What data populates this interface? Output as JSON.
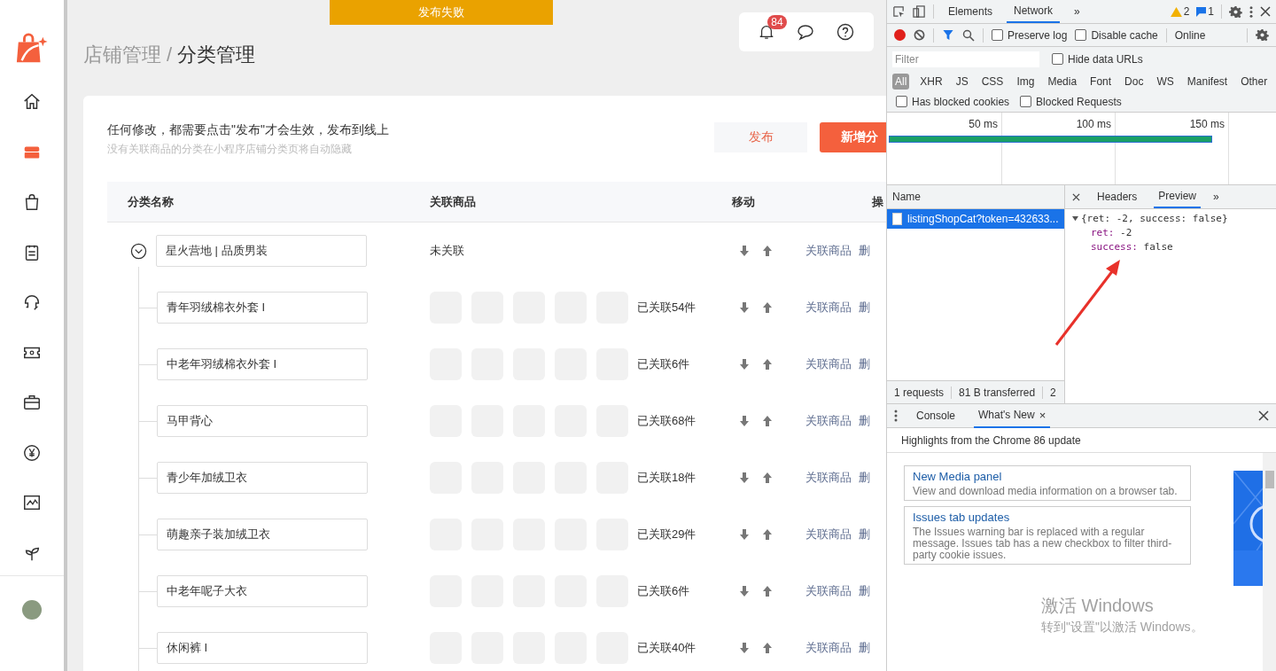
{
  "toast": {
    "text": "发布失败"
  },
  "sidebar": {
    "items": [
      {
        "kind": "home",
        "selected": false
      },
      {
        "kind": "store",
        "selected": true
      },
      {
        "kind": "bag",
        "selected": false
      },
      {
        "kind": "clipboard",
        "selected": false
      },
      {
        "kind": "headset",
        "selected": false
      },
      {
        "kind": "ticket",
        "selected": false
      },
      {
        "kind": "briefcase",
        "selected": false
      },
      {
        "kind": "yen",
        "selected": false
      },
      {
        "kind": "chart",
        "selected": false
      },
      {
        "kind": "sprout",
        "selected": false
      }
    ]
  },
  "header": {
    "breadcrumb": [
      {
        "label": "店铺管理",
        "current": false
      },
      {
        "label": "分类管理",
        "current": true
      }
    ],
    "separator": "/",
    "notification_count": "84"
  },
  "notice": {
    "title": "任何修改，都需要点击\"发布\"才会生效，发布到线上",
    "subtitle": "没有关联商品的分类在小程序店铺分类页将自动隐藏"
  },
  "buttons": {
    "publish": "发布",
    "add": "新增分"
  },
  "table": {
    "columns": [
      "分类名称",
      "关联商品",
      "移动",
      "操"
    ],
    "rows": [
      {
        "name": "星火营地 | 品质男装",
        "expanded": true,
        "linked": "未关联",
        "actions": [
          "关联商品",
          "删"
        ],
        "children": [
          {
            "name": "青年羽绒棉衣外套 I",
            "linked": "已关联54件",
            "actions": [
              "关联商品",
              "删"
            ]
          },
          {
            "name": "中老年羽绒棉衣外套 I",
            "linked": "已关联6件",
            "actions": [
              "关联商品",
              "删"
            ]
          },
          {
            "name": "马甲背心",
            "linked": "已关联68件",
            "actions": [
              "关联商品",
              "删"
            ]
          },
          {
            "name": "青少年加绒卫衣",
            "linked": "已关联18件",
            "actions": [
              "关联商品",
              "删"
            ]
          },
          {
            "name": "萌趣亲子装加绒卫衣",
            "linked": "已关联29件",
            "actions": [
              "关联商品",
              "删"
            ]
          },
          {
            "name": "中老年呢子大衣",
            "linked": "已关联6件",
            "actions": [
              "关联商品",
              "删"
            ]
          },
          {
            "name": "休闲裤 I",
            "linked": "已关联40件",
            "actions": [
              "关联商品",
              "删"
            ]
          }
        ]
      }
    ]
  },
  "devtools": {
    "tabs": [
      {
        "label": "Elements",
        "selected": false
      },
      {
        "label": "Network",
        "selected": true
      }
    ],
    "more": "»",
    "warnings": "2",
    "messages": "1",
    "toolbar": {
      "recording": true,
      "preserve_log": {
        "label": "Preserve log",
        "checked": false
      },
      "disable_cache": {
        "label": "Disable cache",
        "checked": false
      },
      "throttling": "Online"
    },
    "filter": {
      "placeholder": "Filter"
    },
    "hide_data_urls": {
      "label": "Hide data URLs",
      "checked": false
    },
    "type_filters": [
      {
        "label": "All",
        "selected": true
      },
      {
        "label": "XHR",
        "selected": false
      },
      {
        "label": "JS",
        "selected": false
      },
      {
        "label": "CSS",
        "selected": false
      },
      {
        "label": "Img",
        "selected": false
      },
      {
        "label": "Media",
        "selected": false
      },
      {
        "label": "Font",
        "selected": false
      },
      {
        "label": "Doc",
        "selected": false
      },
      {
        "label": "WS",
        "selected": false
      },
      {
        "label": "Manifest",
        "selected": false
      },
      {
        "label": "Other",
        "selected": false
      }
    ],
    "blocked_filters": [
      {
        "label": "Has blocked cookies",
        "checked": false
      },
      {
        "label": "Blocked Requests",
        "checked": false
      }
    ],
    "timeline": {
      "ticks": [
        "50 ms",
        "100 ms",
        "150 ms"
      ],
      "level": 0.83
    },
    "requests": {
      "column": "Name",
      "items": [
        {
          "name": "listingShopCat?token=432633...",
          "selected": true
        }
      ]
    },
    "detail_tabs": [
      {
        "label": "Headers",
        "selected": false
      },
      {
        "label": "Preview",
        "selected": true
      }
    ],
    "preview": {
      "expanded": true,
      "summary": "{ret: -2, success: false}",
      "lines": [
        {
          "key": "ret:",
          "value": "-2"
        },
        {
          "key": "success:",
          "value": "false"
        }
      ]
    },
    "status": [
      "1 requests",
      "81 B transferred",
      "2"
    ],
    "drawer": {
      "tabs": [
        {
          "label": "Console",
          "selected": false
        },
        {
          "label": "What's New",
          "selected": true,
          "close": "×"
        }
      ],
      "heading": "Highlights from the Chrome 86 update",
      "cards": [
        {
          "title": "New Media panel",
          "body": "View and download media information on a browser tab."
        },
        {
          "title": "Issues tab updates",
          "body": "The Issues warning bar is replaced with a regular message. Issues tab has a new checkbox to filter third-party cookie issues."
        }
      ]
    }
  },
  "os_watermark": {
    "title": "激活 Windows",
    "subtitle": "转到\"设置\"以激活 Windows。"
  }
}
